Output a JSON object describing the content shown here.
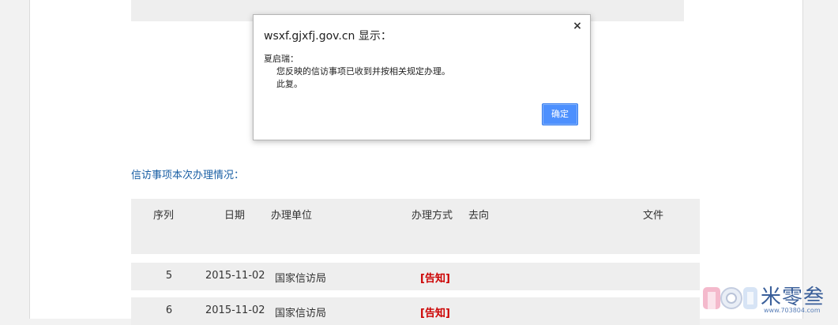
{
  "dialog": {
    "title": "wsxf.gjxfj.gov.cn 显示：",
    "close_glyph": "×",
    "greeting": "夏启瑞：",
    "message": "您反映的信访事项已收到并按相关规定办理。",
    "closing": "此复。",
    "ok_label": "确定"
  },
  "section": {
    "title": "信访事项本次办理情况："
  },
  "table": {
    "headers": {
      "seq": "序列",
      "date": "日期",
      "unit": "办理单位",
      "method": "办理方式",
      "direction": "去向",
      "file": "文件"
    },
    "rows": [
      {
        "seq": "5",
        "date": "2015-11-02",
        "unit": "国家信访局",
        "method": "[告知]"
      },
      {
        "seq": "6",
        "date": "2015-11-02",
        "unit": "国家信访局",
        "method": "[告知]"
      }
    ]
  },
  "watermark": {
    "text": "米零叁",
    "url": "www.703804.com",
    "logo_glyphs": "TO3"
  },
  "colors": {
    "link_blue": "#1a5fa4",
    "method_red": "#cc0000",
    "button_blue": "#4d90fe"
  }
}
